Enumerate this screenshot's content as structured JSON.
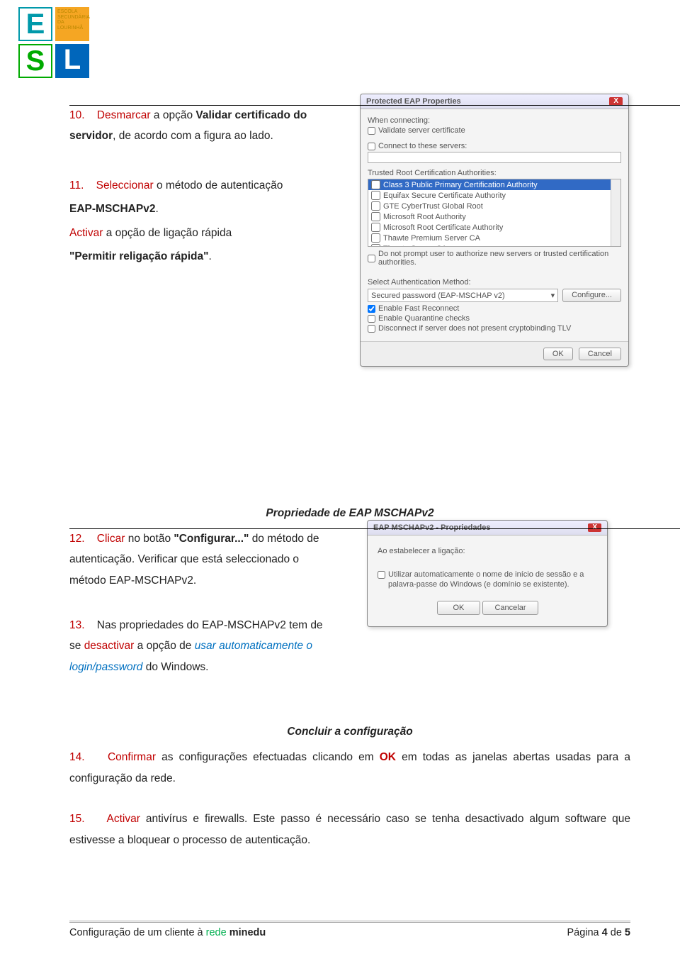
{
  "logo": {
    "esc_text": "ESCOLA SECUNDÁRIA DA LOURINHÃ"
  },
  "steps": {
    "s10": {
      "num": "10.",
      "action": "Desmarcar",
      "obj": "a opção",
      "target": "Validar certificado do servidor",
      "tail": ", de acordo com a figura ao lado."
    },
    "s11": {
      "num": "11.",
      "action": "Seleccionar",
      "obj": "o método de autenticação",
      "target": "EAP-MSCHAPv2",
      "tail2a": "Activar",
      "tail2b": "a opção de ligação rápida",
      "tail2c": "\"Permitir religação rápida\""
    },
    "head12": "Propriedade de EAP MSCHAPv2",
    "s12": {
      "num": "12.",
      "action": "Clicar",
      "obj": "no botão",
      "target": "\"Configurar...\"",
      "tail": "do método de autenticação. Verificar que está seleccionado o método EAP-MSCHAPv2."
    },
    "s13": {
      "num": "13.",
      "pre": "Nas propriedades do EAP-MSCHAPv2 tem de se",
      "act": "desactivar",
      "mid": "a opção de",
      "opt": "usar automaticamente o login/password",
      "tail": "do Windows."
    },
    "head14": "Concluir a configuração",
    "s14": {
      "num": "14.",
      "action": "Confirmar",
      "obj": "as configurações efectuadas clicando em",
      "target": "OK",
      "tail": "em todas as janelas abertas usadas para a configuração da rede."
    },
    "s15": {
      "num": "15.",
      "action": "Activar",
      "obj": "antivírus e firewalls. Este passo é necessário caso se tenha desactivado algum software que estivesse a bloquear o processo de autenticação."
    }
  },
  "dialog1": {
    "title": "Protected EAP Properties",
    "when": "When connecting:",
    "validate": "Validate server certificate",
    "connect": "Connect to these servers:",
    "trusted": "Trusted Root Certification Authorities:",
    "cas": [
      "Class 3 Public Primary Certification Authority",
      "Equifax Secure Certificate Authority",
      "GTE CyberTrust Global Root",
      "Microsoft Root Authority",
      "Microsoft Root Certificate Authority",
      "Thawte Premium Server CA",
      "Thawte Server CA"
    ],
    "noprompt": "Do not prompt user to authorize new servers or trusted certification authorities.",
    "selauth": "Select Authentication Method:",
    "method": "Secured password (EAP-MSCHAP v2)",
    "configure": "Configure...",
    "fast": "Enable Fast Reconnect",
    "quarantine": "Enable Quarantine checks",
    "disconnect": "Disconnect if server does not present cryptobinding TLV",
    "ok": "OK",
    "cancel": "Cancel"
  },
  "dialog2": {
    "title": "EAP MSCHAPv2 - Propriedades",
    "label": "Ao estabelecer a ligação:",
    "opt": "Utilizar automaticamente o nome de início de sessão e a palavra-passe do Windows (e domínio se existente).",
    "ok": "OK",
    "cancel": "Cancelar"
  },
  "footer": {
    "left_a": "Configuração de um cliente à",
    "left_b": "rede",
    "left_c": "minedu",
    "right_a": "Página",
    "right_b": "4",
    "right_c": "de",
    "right_d": "5"
  }
}
